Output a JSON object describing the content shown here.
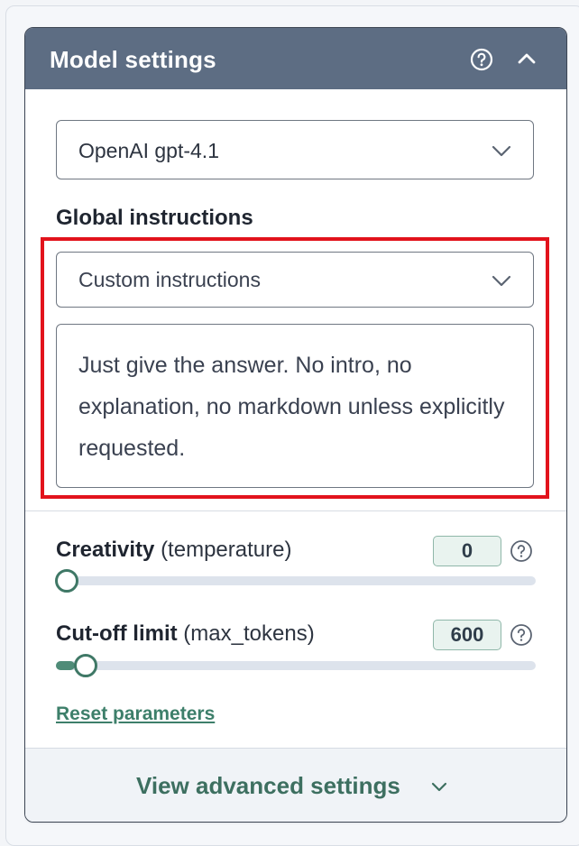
{
  "panel": {
    "title": "Model settings",
    "help_icon": "help-circle-icon",
    "collapse_icon": "chevron-up-icon"
  },
  "model": {
    "selected": "OpenAI gpt-4.1"
  },
  "global_instructions": {
    "label": "Global instructions",
    "selected": "Custom instructions",
    "text": "Just give the answer. No intro, no explanation, no markdown unless explicitly requested."
  },
  "parameters": {
    "creativity": {
      "label_bold": "Creativity",
      "label_param": "(temperature)",
      "value": "0",
      "slider_fraction": 0.0
    },
    "cutoff": {
      "label_bold": "Cut-off limit",
      "label_param": "(max_tokens)",
      "value": "600",
      "slider_fraction": 0.04
    },
    "reset_label": "Reset parameters"
  },
  "footer": {
    "label": "View advanced settings",
    "icon": "chevron-down-icon"
  },
  "colors": {
    "header_bg": "#5d6d83",
    "accent_green": "#3d7f6a",
    "highlight_red": "#e2131c"
  }
}
